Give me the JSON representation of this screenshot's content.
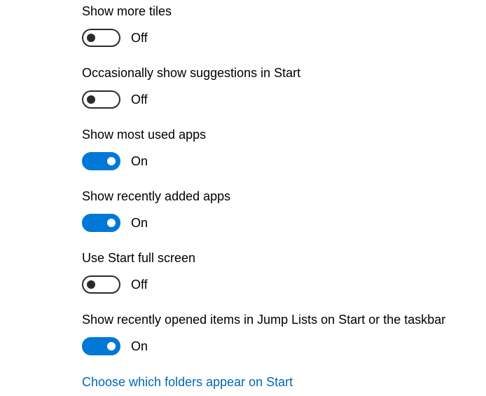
{
  "settings": [
    {
      "label": "Show more tiles",
      "state": "Off",
      "on": false
    },
    {
      "label": "Occasionally show suggestions in Start",
      "state": "Off",
      "on": false
    },
    {
      "label": "Show most used apps",
      "state": "On",
      "on": true
    },
    {
      "label": "Show recently added apps",
      "state": "On",
      "on": true
    },
    {
      "label": "Use Start full screen",
      "state": "Off",
      "on": false
    },
    {
      "label": "Show recently opened items in Jump Lists on Start or the taskbar",
      "state": "On",
      "on": true
    }
  ],
  "folders_link": "Choose which folders appear on Start",
  "colors": {
    "accent": "#0078d7",
    "link": "#0067b8",
    "toggle_off": "#2b2b2b"
  }
}
